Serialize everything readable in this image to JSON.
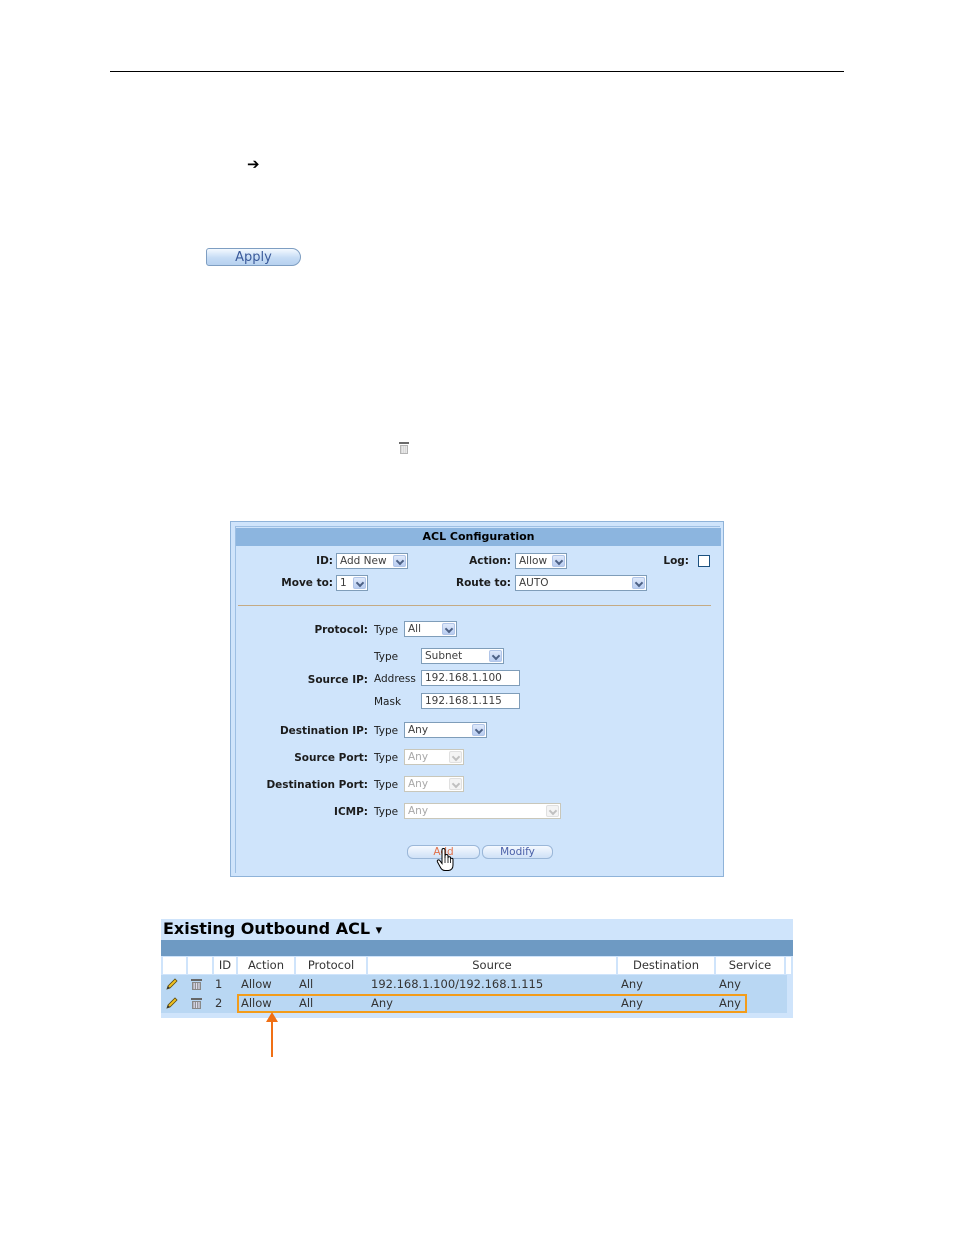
{
  "document": {
    "arrow_glyph": "➔",
    "apply_button": "Apply",
    "inline_icon": "trash-icon"
  },
  "acl_config": {
    "title": "ACL Configuration",
    "id_label": "ID:",
    "id_value": "Add New",
    "action_label": "Action:",
    "action_value": "Allow",
    "log_label": "Log:",
    "log_checked": false,
    "move_to_label": "Move to:",
    "move_to_value": "1",
    "route_to_label": "Route to:",
    "route_to_value": "AUTO",
    "protocol_label": "Protocol:",
    "protocol_type_label": "Type",
    "protocol_type_value": "All",
    "source_ip_label": "Source IP:",
    "source_type_label": "Type",
    "source_type_value": "Subnet",
    "source_address_label": "Address",
    "source_address_value": "192.168.1.100",
    "source_mask_label": "Mask",
    "source_mask_value": "192.168.1.115",
    "dest_ip_label": "Destination IP:",
    "dest_ip_type_label": "Type",
    "dest_ip_type_value": "Any",
    "source_port_label": "Source Port:",
    "source_port_type_label": "Type",
    "source_port_type_value": "Any",
    "dest_port_label": "Destination Port:",
    "dest_port_type_label": "Type",
    "dest_port_type_value": "Any",
    "icmp_label": "ICMP:",
    "icmp_type_label": "Type",
    "icmp_type_value": "Any",
    "add_button": "Add",
    "modify_button": "Modify"
  },
  "existing_acl": {
    "title": "Existing Outbound ACL",
    "title_icon": "▾",
    "columns": [
      "",
      "",
      "ID",
      "Action",
      "Protocol",
      "Source",
      "Destination",
      "Service"
    ],
    "rows": [
      {
        "id": "1",
        "action": "Allow",
        "protocol": "All",
        "source": "192.168.1.100/192.168.1.115",
        "destination": "Any",
        "service": "Any"
      },
      {
        "id": "2",
        "action": "Allow",
        "protocol": "All",
        "source": "Any",
        "destination": "Any",
        "service": "Any"
      }
    ],
    "highlight_color": "#f39c1a",
    "callout_color": "#f07015"
  }
}
